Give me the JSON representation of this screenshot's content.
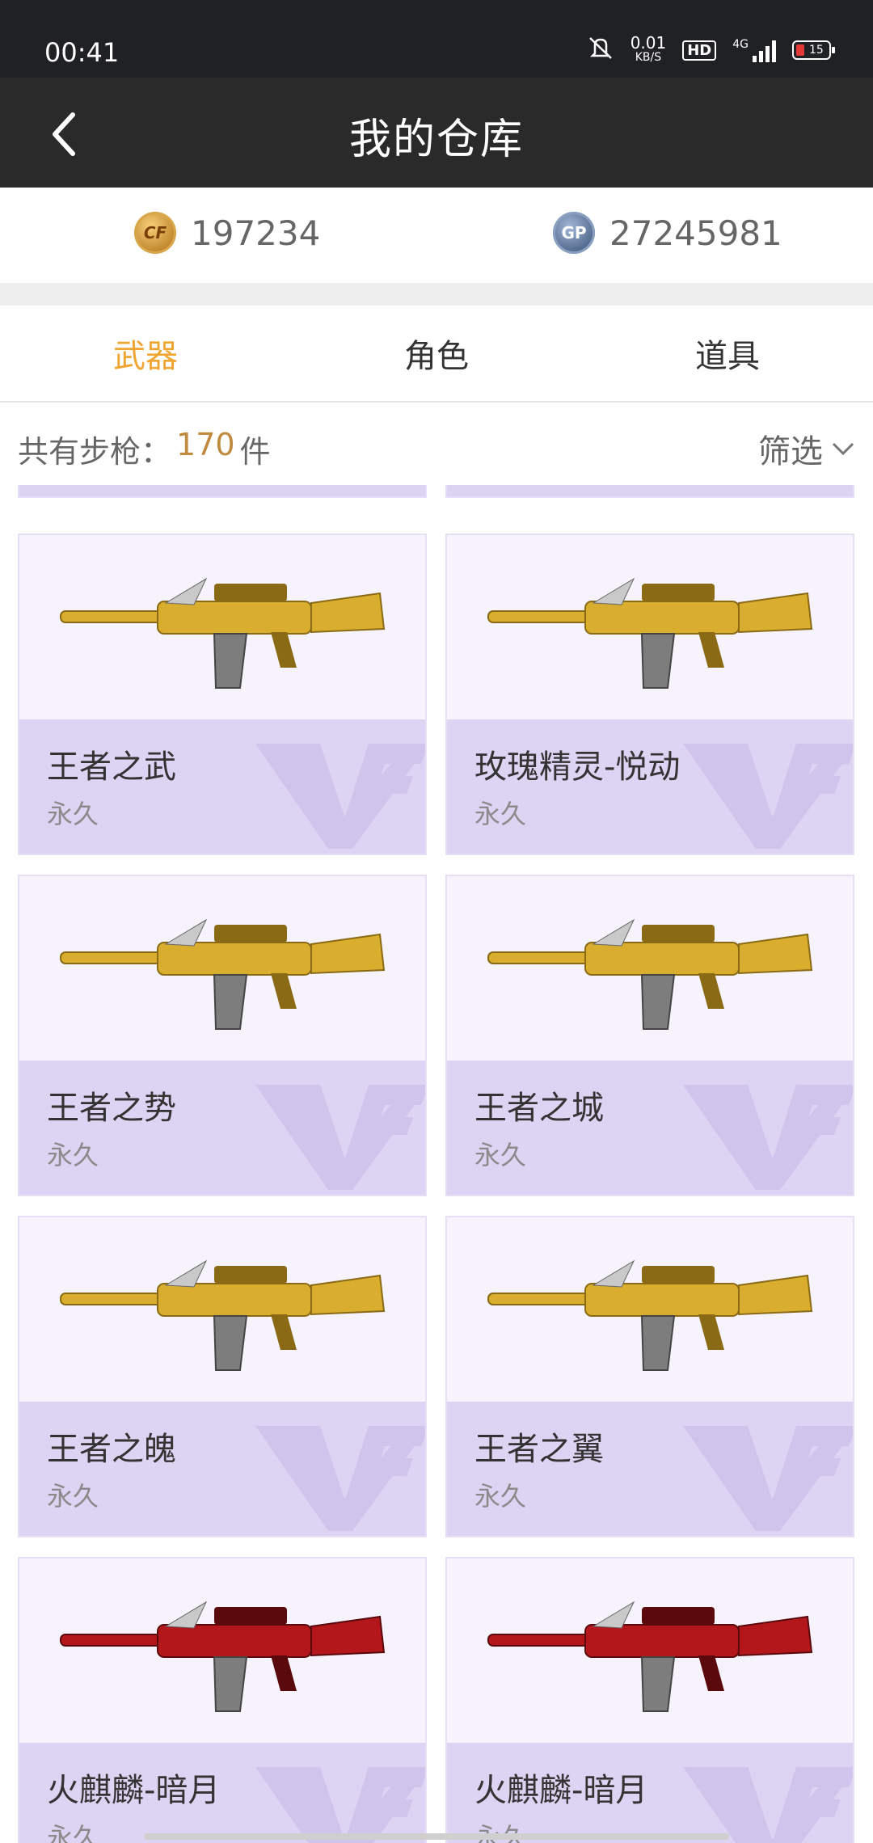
{
  "status_bar": {
    "time": "00:41",
    "net_speed_value": "0.01",
    "net_speed_unit": "KB/S",
    "hd_badge": "HD",
    "network_type": "4G",
    "battery_level": "15"
  },
  "header": {
    "title": "我的仓库"
  },
  "currencies": {
    "cf_points": "197234",
    "gp_label": "GP",
    "gp_points": "27245981"
  },
  "tabs": [
    {
      "label": "武器",
      "active": true
    },
    {
      "label": "角色",
      "active": false
    },
    {
      "label": "道具",
      "active": false
    }
  ],
  "summary": {
    "prefix": "共有步枪：",
    "count": "170",
    "suffix": "件",
    "filter_label": "筛选"
  },
  "items": [
    {
      "name": "王者之武",
      "duration": "永久",
      "color": "gold"
    },
    {
      "name": "玫瑰精灵-悦动",
      "duration": "永久",
      "color": "gold"
    },
    {
      "name": "王者之势",
      "duration": "永久",
      "color": "gold"
    },
    {
      "name": "王者之城",
      "duration": "永久",
      "color": "gold"
    },
    {
      "name": "王者之魄",
      "duration": "永久",
      "color": "gold"
    },
    {
      "name": "王者之翼",
      "duration": "永久",
      "color": "gold"
    },
    {
      "name": "火麒麟-暗月",
      "duration": "永久",
      "color": "red"
    },
    {
      "name": "火麒麟-暗月",
      "duration": "永久",
      "color": "red"
    }
  ],
  "colors": {
    "accent": "#f0a530",
    "header_bg": "#2a2a2a",
    "card_info_bg": "#ddd3f2",
    "count_color": "#c08a3e"
  }
}
